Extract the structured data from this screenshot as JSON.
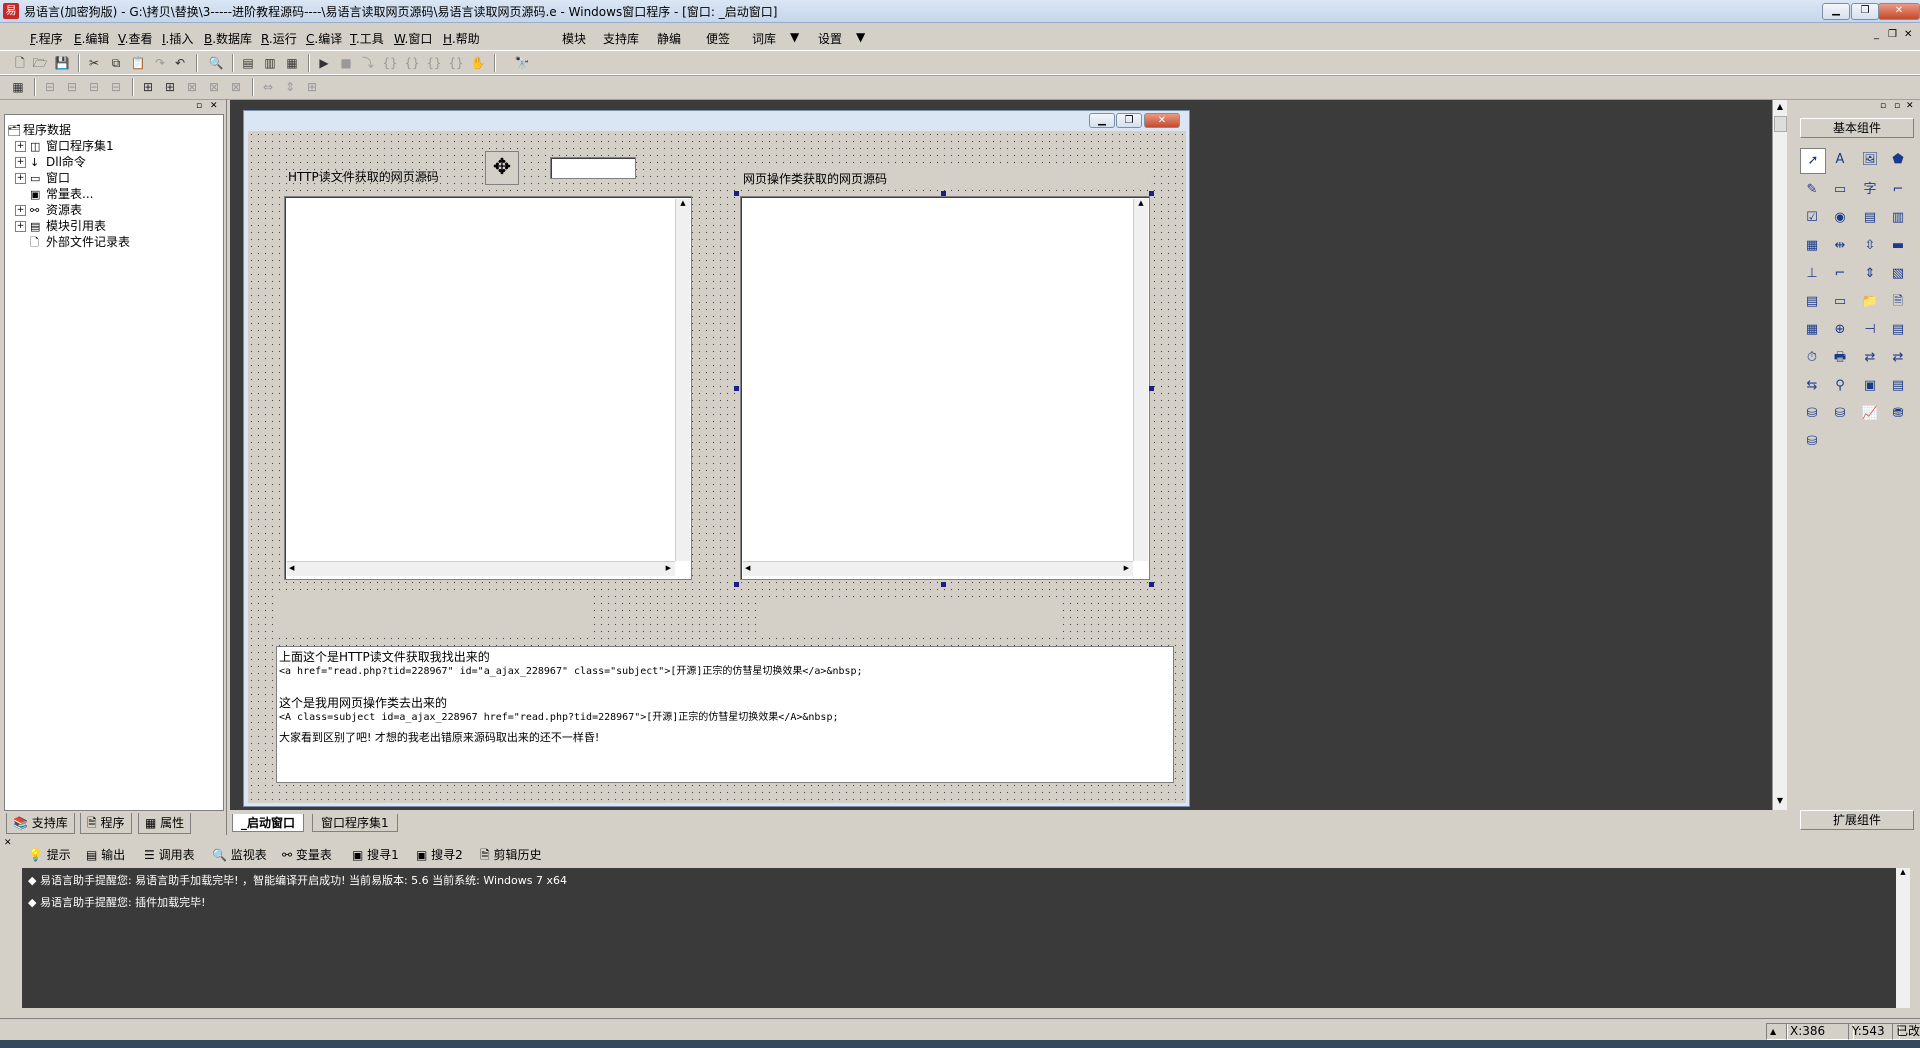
{
  "title_bar": {
    "text": "易语言(加密狗版) - G:\\拷贝\\替换\\3-----进阶教程源码----\\易语言读取网页源码\\易语言读取网页源码.e - Windows窗口程序 - [窗口: _启动窗口]"
  },
  "menu": {
    "items": [
      {
        "key": "F",
        "label": ".程序"
      },
      {
        "key": "E",
        "label": ".编辑"
      },
      {
        "key": "V",
        "label": ".查看"
      },
      {
        "key": "I",
        "label": ".插入"
      },
      {
        "key": "B",
        "label": ".数据库"
      },
      {
        "key": "R",
        "label": ".运行"
      },
      {
        "key": "C",
        "label": ".编译"
      },
      {
        "key": "T",
        "label": ".工具"
      },
      {
        "key": "W",
        "label": ".窗口"
      },
      {
        "key": "H",
        "label": ".帮助"
      }
    ],
    "extra": [
      "模块",
      "支持库",
      "静编",
      "便签",
      "词库",
      "设置"
    ]
  },
  "tree": {
    "root": "程序数据",
    "items": [
      "窗口程序集1",
      "Dll命令",
      "窗口",
      "常量表...",
      "资源表",
      "模块引用表",
      "外部文件记录表"
    ]
  },
  "left_tabs": [
    "支持库",
    "程序",
    "属性"
  ],
  "form": {
    "label_http": "HTTP读文件获取的网页源码",
    "label_web": "网页操作类获取的网页源码",
    "notes": [
      "上面这个是HTTP读文件获取我找出来的",
      "<a href=\"read.php?tid=228967\" id=\"a_ajax_228967\" class=\"subject\">[开源]正宗的仿彗星切换效果</a>&nbsp;",
      "这个是我用网页操作类去出来的",
      "<A class=subject id=a_ajax_228967 href=\"read.php?tid=228967\">[开源]正宗的仿彗星切换效果</A>&nbsp;",
      "大家看到区别了吧! 才想的我老出错原来源码取出来的还不一样昏!"
    ]
  },
  "design_tabs": [
    "_启动窗口",
    "窗口程序集1"
  ],
  "right_panel": {
    "header": "基本组件",
    "footer": "扩展组件"
  },
  "output_tabs": [
    "提示",
    "输出",
    "调用表",
    "监视表",
    "变量表",
    "搜寻1",
    "搜寻2",
    "剪辑历史"
  ],
  "output_lines": [
    "易语言助手提醒您: 易语言助手加载完毕! ，智能编译开启成功!  当前易版本: 5.6  当前系统: Windows 7 x64",
    "易语言助手提醒您: 插件加载完毕!"
  ],
  "status": {
    "x": "X:386",
    "y": "Y:543",
    "state": "已改"
  },
  "colors": {
    "design_bg": "#3b3b3b",
    "output_bg": "#3a3a3a",
    "handle": "#1c1c8a"
  }
}
